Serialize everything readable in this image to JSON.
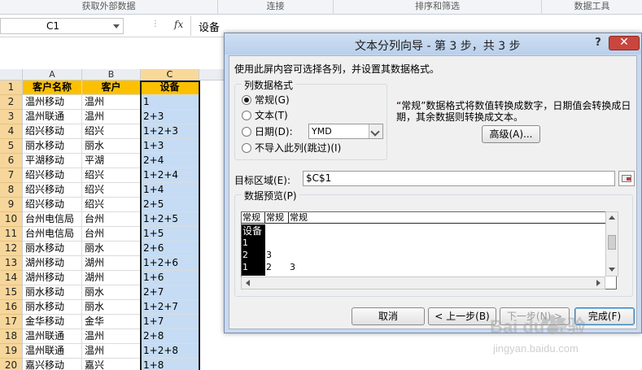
{
  "ribbon": {
    "groups": [
      "获取外部数据",
      "连接",
      "排序和筛选",
      "数据工具"
    ]
  },
  "formula_bar": {
    "name_box": "C1",
    "fx_label": "fx",
    "value": "设备"
  },
  "sheet": {
    "columns": [
      "A",
      "B",
      "C"
    ],
    "selected_column": "C",
    "rows": [
      {
        "num": "1",
        "a": "客户名称",
        "b": "客户",
        "c": "设备"
      },
      {
        "num": "2",
        "a": "温州移动",
        "b": "温州",
        "c": "1"
      },
      {
        "num": "3",
        "a": "温州联通",
        "b": "温州",
        "c": "2+3"
      },
      {
        "num": "4",
        "a": "绍兴移动",
        "b": "绍兴",
        "c": "1+2+3"
      },
      {
        "num": "5",
        "a": "丽水移动",
        "b": "丽水",
        "c": "1+3"
      },
      {
        "num": "6",
        "a": "平湖移动",
        "b": "平湖",
        "c": "2+4"
      },
      {
        "num": "7",
        "a": "绍兴移动",
        "b": "绍兴",
        "c": "1+2+4"
      },
      {
        "num": "8",
        "a": "绍兴移动",
        "b": "绍兴",
        "c": "1+4"
      },
      {
        "num": "9",
        "a": "绍兴移动",
        "b": "绍兴",
        "c": "2+5"
      },
      {
        "num": "10",
        "a": "台州电信局",
        "b": "台州",
        "c": "1+2+5"
      },
      {
        "num": "11",
        "a": "台州电信局",
        "b": "台州",
        "c": "1+5"
      },
      {
        "num": "12",
        "a": "丽水移动",
        "b": "丽水",
        "c": "2+6"
      },
      {
        "num": "13",
        "a": "湖州移动",
        "b": "湖州",
        "c": "1+2+6"
      },
      {
        "num": "14",
        "a": "湖州移动",
        "b": "湖州",
        "c": "1+6"
      },
      {
        "num": "15",
        "a": "丽水移动",
        "b": "丽水",
        "c": "2+7"
      },
      {
        "num": "16",
        "a": "丽水移动",
        "b": "丽水",
        "c": "1+2+7"
      },
      {
        "num": "17",
        "a": "金华移动",
        "b": "金华",
        "c": "1+7"
      },
      {
        "num": "18",
        "a": "温州联通",
        "b": "温州",
        "c": "2+8"
      },
      {
        "num": "19",
        "a": "温州联通",
        "b": "温州",
        "c": "1+2+8"
      },
      {
        "num": "20",
        "a": "嘉兴移动",
        "b": "嘉兴",
        "c": "1+8"
      }
    ]
  },
  "dialog": {
    "title": "文本分列向导 - 第 3 步，共 3 步",
    "help_label": "?",
    "close_label": "✕",
    "instruction": "使用此屏内容可选择各列，并设置其数据格式。",
    "format_group_label": "列数据格式",
    "options": [
      {
        "label": "常规(G)",
        "selected": true
      },
      {
        "label": "文本(T)",
        "selected": false
      },
      {
        "label": "日期(D):",
        "selected": false
      },
      {
        "label": "不导入此列(跳过)(I)",
        "selected": false
      }
    ],
    "date_format": "YMD",
    "description": "“常规”数据格式将数值转换成数字，日期值会转换成日期，其余数据则转换成文本。",
    "advanced_button": "高级(A)...",
    "target_label": "目标区域(E):",
    "target_value": "$C$1",
    "preview_label": "数据预览(P)",
    "preview": {
      "headers": [
        "常规",
        "常规",
        "常规"
      ],
      "col1": [
        "设备",
        "1",
        "2",
        "1"
      ],
      "col2": [
        "",
        "",
        "3",
        "2"
      ],
      "col3": [
        "",
        "",
        "",
        "3"
      ]
    },
    "buttons": {
      "cancel": "取消",
      "back": "< 上一步(B)",
      "next": "下一步(N) >",
      "finish": "完成(F)"
    }
  },
  "watermark": {
    "brand": "Bai du 经验",
    "url": "jingyan.baidu.com"
  }
}
